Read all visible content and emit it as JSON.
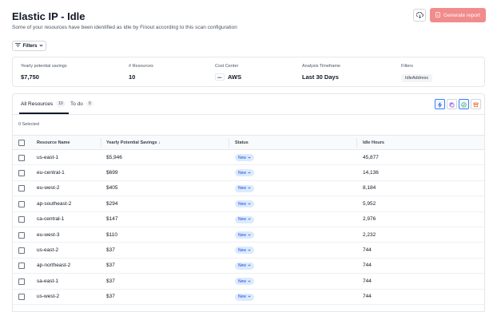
{
  "header": {
    "title": "Elastic IP - Idle",
    "subtitle": "Some of your resources have been identified as idle by Finout according to this scan configuration",
    "generate_label": "Generate report"
  },
  "filters": {
    "label": "Filters"
  },
  "summary": {
    "savings_label": "Yearly potential savings",
    "savings_value": "$7,750",
    "resources_label": "# Resources",
    "resources_value": "10",
    "cost_center_label": "Cost Center",
    "cost_center_value": "AWS",
    "aws_logo_text": "aws",
    "timeframe_label": "Analysis Timeframe",
    "timeframe_value": "Last 30 Days",
    "filters_label": "Filters",
    "filters_chip": "IdleAddress"
  },
  "tabs": [
    {
      "label": "All Resources",
      "count": "10"
    },
    {
      "label": "To do",
      "count": "0"
    }
  ],
  "selected_text": "0 Selected",
  "table": {
    "headers": [
      "Resource Name",
      "Yearly Potential Savings ↓",
      "Status",
      "Idle Hours"
    ],
    "rows": [
      {
        "name": "us-east-1",
        "savings": "$5,946",
        "status": "New",
        "hours": "45,877"
      },
      {
        "name": "eu-central-1",
        "savings": "$699",
        "status": "New",
        "hours": "14,136"
      },
      {
        "name": "eu-west-2",
        "savings": "$405",
        "status": "New",
        "hours": "8,184"
      },
      {
        "name": "ap-southeast-2",
        "savings": "$294",
        "status": "New",
        "hours": "5,952"
      },
      {
        "name": "ca-central-1",
        "savings": "$147",
        "status": "New",
        "hours": "2,976"
      },
      {
        "name": "eu-west-3",
        "savings": "$110",
        "status": "New",
        "hours": "2,232"
      },
      {
        "name": "us-east-2",
        "savings": "$37",
        "status": "New",
        "hours": "744"
      },
      {
        "name": "ap-northeast-2",
        "savings": "$37",
        "status": "New",
        "hours": "744"
      },
      {
        "name": "sa-east-1",
        "savings": "$37",
        "status": "New",
        "hours": "744"
      },
      {
        "name": "us-west-2",
        "savings": "$37",
        "status": "New",
        "hours": "744"
      }
    ]
  },
  "colors": {
    "generate_button": "#f28b8b",
    "status_badge_bg": "#dbeafe",
    "status_badge_text": "#1d4ed8",
    "active_action": "#3b82f6"
  }
}
